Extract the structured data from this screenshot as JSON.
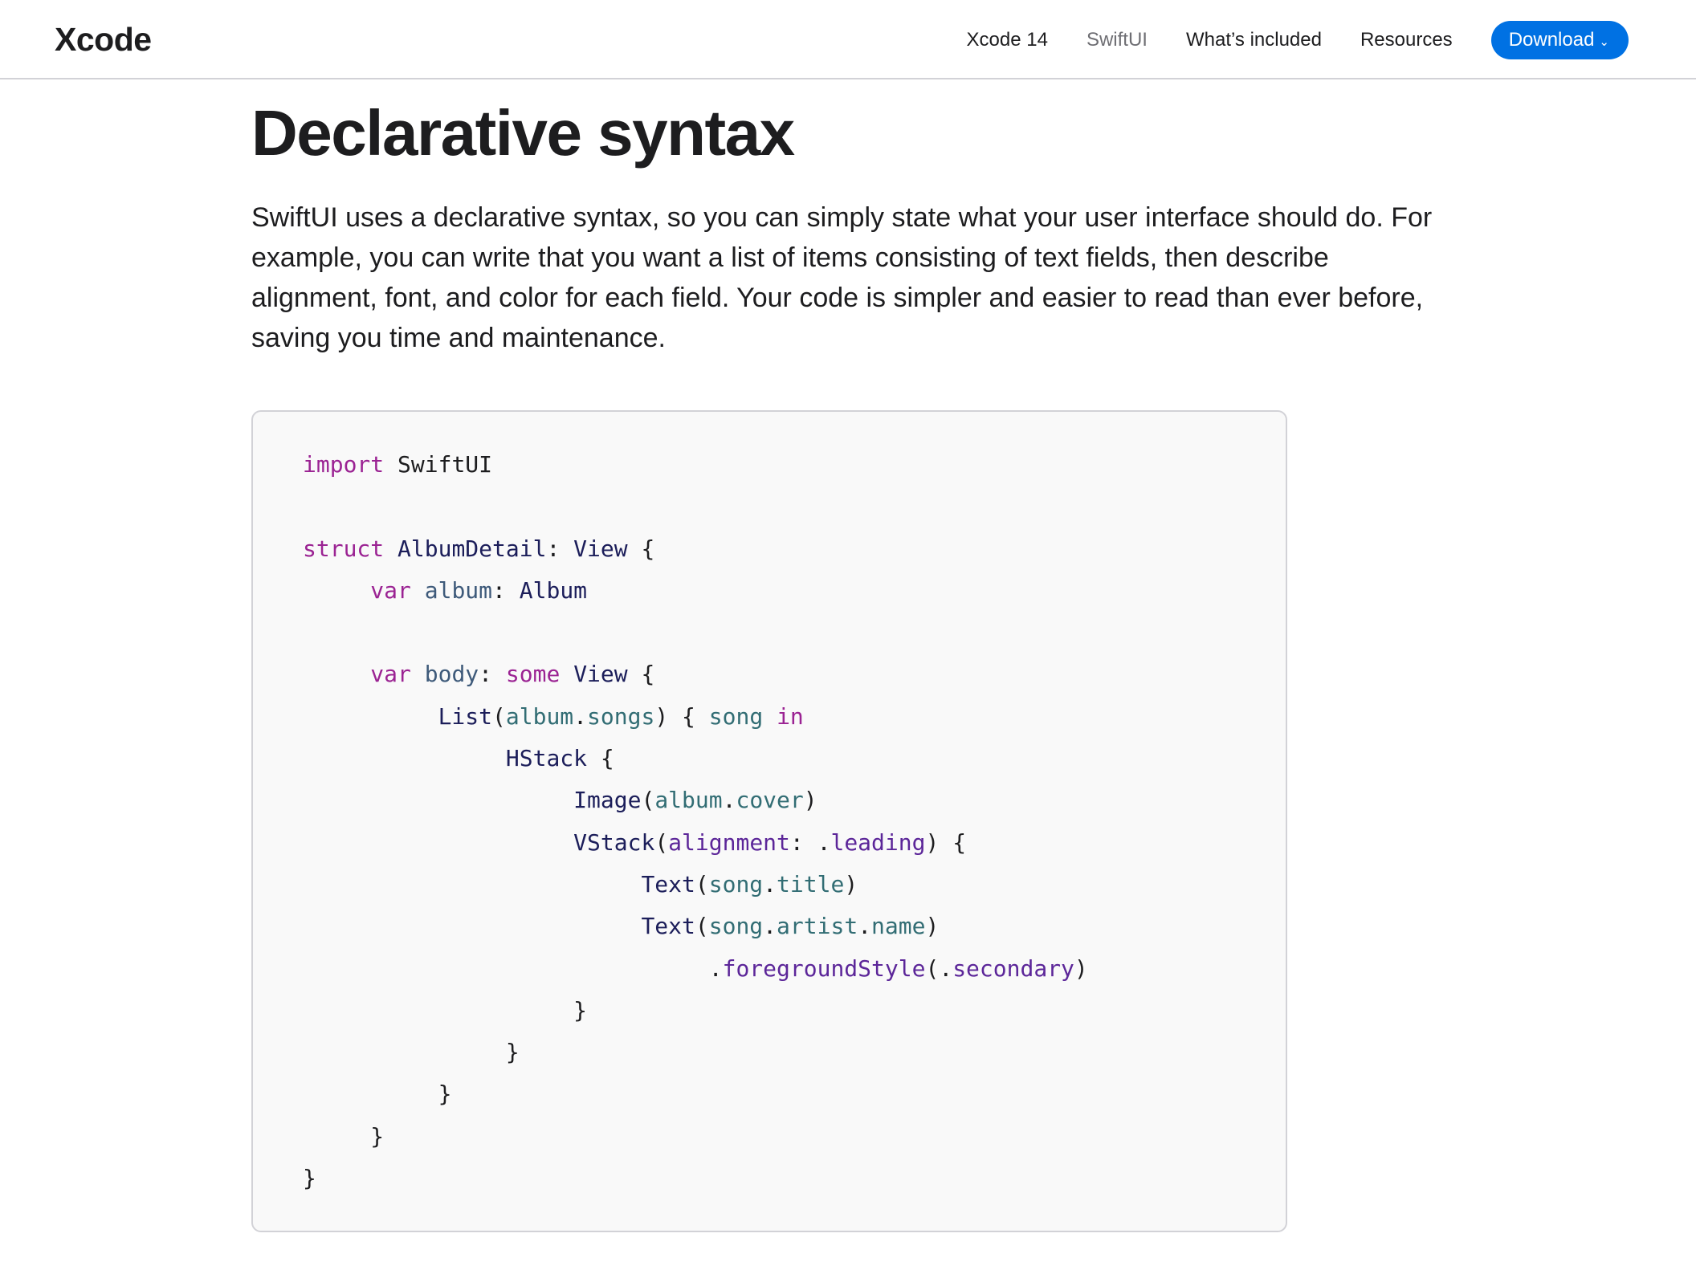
{
  "navbar": {
    "brand": "Xcode",
    "links": [
      {
        "label": "Xcode 14"
      },
      {
        "label": "SwiftUI"
      },
      {
        "label": "What’s included"
      },
      {
        "label": "Resources"
      }
    ],
    "download_label": "Download",
    "download_chevron": "⌄",
    "accent_color": "#0071e3"
  },
  "section": {
    "title": "Declarative syntax",
    "body": "SwiftUI uses a declarative syntax, so you can simply state what your user interface should do. For example, you can write that you want a list of items consisting of text fields, then describe alignment, font, and color for each field. Your code is simpler and easier to read than ever before, saving you time and maintenance."
  },
  "code_lines": [
    {
      "indent": 0,
      "tokens": [
        {
          "t": "import",
          "k": "kw"
        },
        {
          "t": " ",
          "k": "punct"
        },
        {
          "t": "SwiftUI",
          "k": "id"
        }
      ]
    },
    {
      "indent": 0,
      "tokens": []
    },
    {
      "indent": 0,
      "tokens": [
        {
          "t": "struct",
          "k": "kw"
        },
        {
          "t": " ",
          "k": "punct"
        },
        {
          "t": "AlbumDetail",
          "k": "type"
        },
        {
          "t": ": ",
          "k": "punct"
        },
        {
          "t": "View",
          "k": "type"
        },
        {
          "t": " {",
          "k": "punct"
        }
      ]
    },
    {
      "indent": 1,
      "tokens": [
        {
          "t": "var",
          "k": "kw"
        },
        {
          "t": " ",
          "k": "punct"
        },
        {
          "t": "album",
          "k": "var"
        },
        {
          "t": ": ",
          "k": "punct"
        },
        {
          "t": "Album",
          "k": "type"
        }
      ]
    },
    {
      "indent": 0,
      "tokens": []
    },
    {
      "indent": 1,
      "tokens": [
        {
          "t": "var",
          "k": "kw"
        },
        {
          "t": " ",
          "k": "punct"
        },
        {
          "t": "body",
          "k": "var"
        },
        {
          "t": ": ",
          "k": "punct"
        },
        {
          "t": "some",
          "k": "kw"
        },
        {
          "t": " ",
          "k": "punct"
        },
        {
          "t": "View",
          "k": "type"
        },
        {
          "t": " {",
          "k": "punct"
        }
      ]
    },
    {
      "indent": 2,
      "tokens": [
        {
          "t": "List",
          "k": "type"
        },
        {
          "t": "(",
          "k": "punct"
        },
        {
          "t": "album",
          "k": "prop"
        },
        {
          "t": ".",
          "k": "punct"
        },
        {
          "t": "songs",
          "k": "prop"
        },
        {
          "t": ") { ",
          "k": "punct"
        },
        {
          "t": "song",
          "k": "prop"
        },
        {
          "t": " ",
          "k": "punct"
        },
        {
          "t": "in",
          "k": "kw"
        }
      ]
    },
    {
      "indent": 3,
      "tokens": [
        {
          "t": "HStack",
          "k": "type"
        },
        {
          "t": " {",
          "k": "punct"
        }
      ]
    },
    {
      "indent": 4,
      "tokens": [
        {
          "t": "Image",
          "k": "type"
        },
        {
          "t": "(",
          "k": "punct"
        },
        {
          "t": "album",
          "k": "prop"
        },
        {
          "t": ".",
          "k": "punct"
        },
        {
          "t": "cover",
          "k": "prop"
        },
        {
          "t": ")",
          "k": "punct"
        }
      ]
    },
    {
      "indent": 4,
      "tokens": [
        {
          "t": "VStack",
          "k": "type"
        },
        {
          "t": "(",
          "k": "punct"
        },
        {
          "t": "alignment",
          "k": "mem"
        },
        {
          "t": ": .",
          "k": "punct"
        },
        {
          "t": "leading",
          "k": "mem"
        },
        {
          "t": ") {",
          "k": "punct"
        }
      ]
    },
    {
      "indent": 5,
      "tokens": [
        {
          "t": "Text",
          "k": "type"
        },
        {
          "t": "(",
          "k": "punct"
        },
        {
          "t": "song",
          "k": "prop"
        },
        {
          "t": ".",
          "k": "punct"
        },
        {
          "t": "title",
          "k": "prop"
        },
        {
          "t": ")",
          "k": "punct"
        }
      ]
    },
    {
      "indent": 5,
      "tokens": [
        {
          "t": "Text",
          "k": "type"
        },
        {
          "t": "(",
          "k": "punct"
        },
        {
          "t": "song",
          "k": "prop"
        },
        {
          "t": ".",
          "k": "punct"
        },
        {
          "t": "artist",
          "k": "prop"
        },
        {
          "t": ".",
          "k": "punct"
        },
        {
          "t": "name",
          "k": "prop"
        },
        {
          "t": ")",
          "k": "punct"
        }
      ]
    },
    {
      "indent": 6,
      "tokens": [
        {
          "t": ".",
          "k": "punct"
        },
        {
          "t": "foregroundStyle",
          "k": "mem"
        },
        {
          "t": "(.",
          "k": "punct"
        },
        {
          "t": "secondary",
          "k": "mem"
        },
        {
          "t": ")",
          "k": "punct"
        }
      ]
    },
    {
      "indent": 4,
      "tokens": [
        {
          "t": "}",
          "k": "punct"
        }
      ]
    },
    {
      "indent": 3,
      "tokens": [
        {
          "t": "}",
          "k": "punct"
        }
      ]
    },
    {
      "indent": 2,
      "tokens": [
        {
          "t": "}",
          "k": "punct"
        }
      ]
    },
    {
      "indent": 1,
      "tokens": [
        {
          "t": "}",
          "k": "punct"
        }
      ]
    },
    {
      "indent": 0,
      "tokens": [
        {
          "t": "}",
          "k": "punct"
        }
      ]
    }
  ]
}
